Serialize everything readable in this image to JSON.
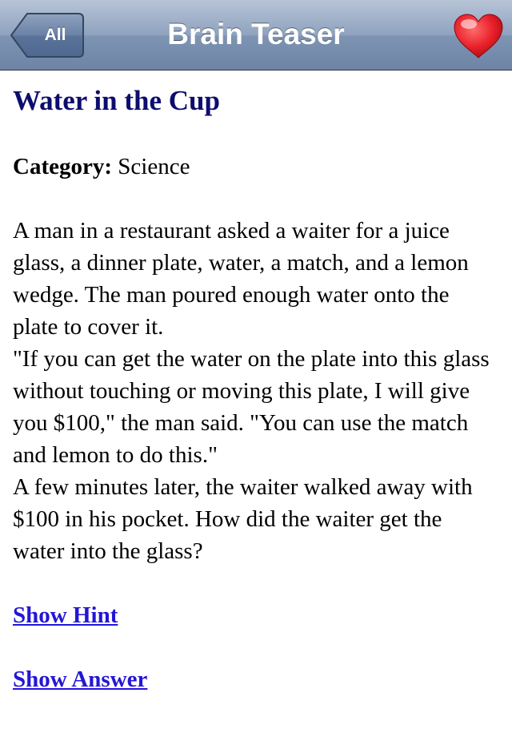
{
  "nav": {
    "back_label": "All",
    "title": "Brain Teaser",
    "favorite_icon": "heart-icon"
  },
  "teaser": {
    "title": "Water in the Cup",
    "category_label": "Category:",
    "category_value": "Science",
    "text": "A man in a restaurant asked a waiter for a juice glass, a dinner plate, water, a match, and a lemon wedge. The man poured enough water onto the plate to cover it.\n\"If you can get the water on the plate into this glass without touching or moving this plate, I will give you $100,\" the man said. \"You can use the match and lemon to do this.\"\nA few minutes later, the waiter walked away with $100 in his pocket. How did the waiter get the water into the glass?",
    "hint_link": "Show Hint",
    "answer_link": "Show Answer"
  },
  "colors": {
    "title": "#0d0d6e",
    "link": "#2316d6",
    "heart": "#e8202a"
  }
}
